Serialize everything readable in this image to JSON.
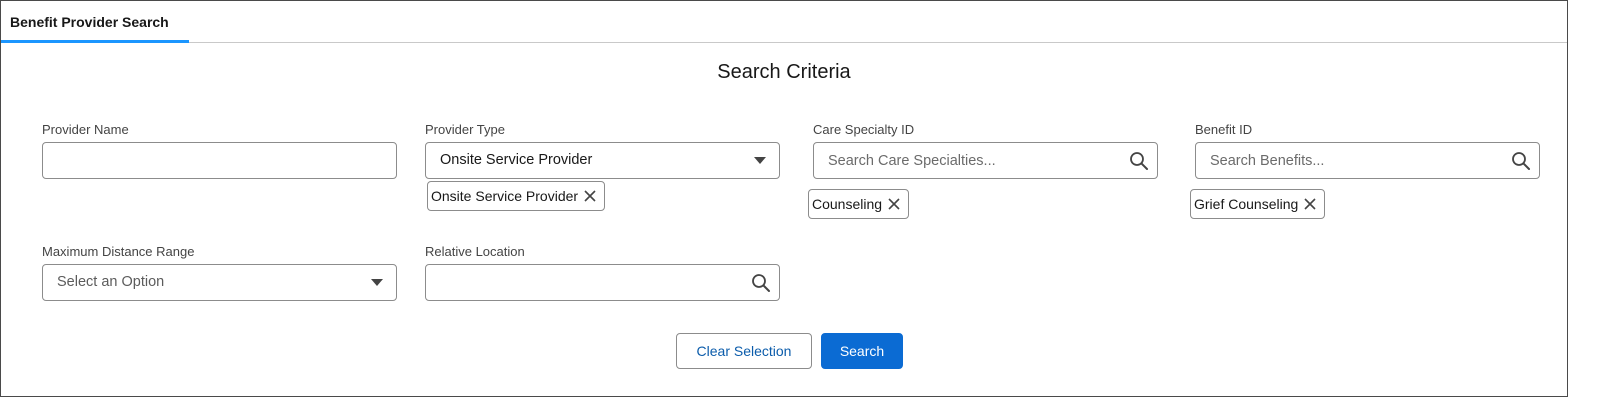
{
  "tab": {
    "label": "Benefit Provider Search"
  },
  "section": {
    "title": "Search Criteria"
  },
  "provider_name": {
    "label": "Provider Name",
    "value": "",
    "placeholder": ""
  },
  "provider_type": {
    "label": "Provider Type",
    "selected": "Onsite Service Provider",
    "pills": [
      "Onsite Service Provider"
    ]
  },
  "care_specialty": {
    "label": "Care Specialty ID",
    "placeholder": "Search Care Specialties...",
    "pills": [
      "Counseling"
    ]
  },
  "benefit": {
    "label": "Benefit ID",
    "placeholder": "Search Benefits...",
    "pills": [
      "Grief Counseling"
    ]
  },
  "max_distance": {
    "label": "Maximum Distance Range",
    "selected": "Select an Option"
  },
  "relative_location": {
    "label": "Relative Location",
    "placeholder": ""
  },
  "buttons": {
    "clear": "Clear Selection",
    "search": "Search"
  },
  "colors": {
    "brand": "#0b6bd3",
    "tab_indicator": "#1b96ff",
    "link": "#0b5cab"
  },
  "icons": {
    "search": "search-icon",
    "close": "close-icon",
    "dropdown": "chevron-down-icon"
  }
}
